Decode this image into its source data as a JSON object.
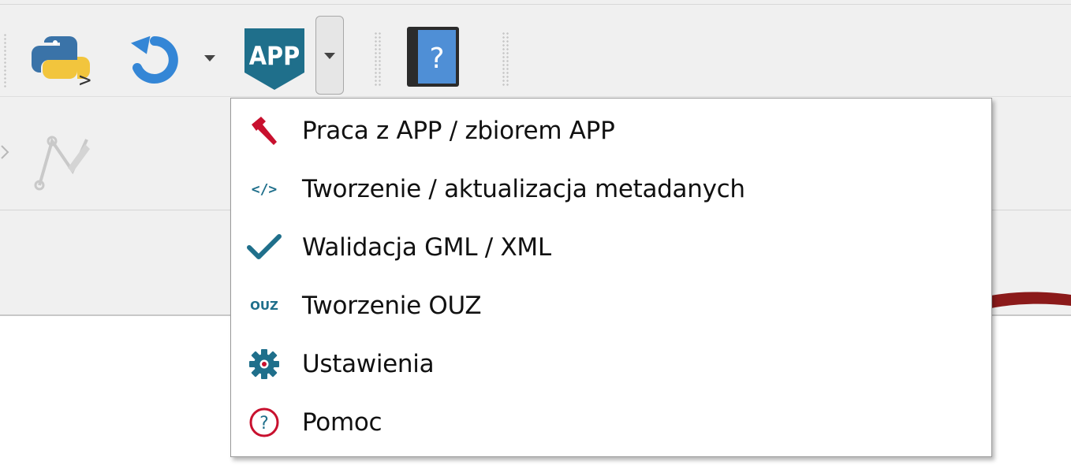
{
  "toolbar": {
    "python_button": "python-console",
    "refresh_button": "refresh",
    "app_button_badge": "APP",
    "help_book_mark": "?"
  },
  "menu": {
    "items": [
      {
        "label": "Praca z APP / zbiorem APP",
        "icon": "hammer-icon",
        "color": "#c8102e"
      },
      {
        "label": "Tworzenie / aktualizacja metadanych",
        "icon": "code-tag-icon",
        "icon_text": "</>",
        "color": "#c8102e"
      },
      {
        "label": "Walidacja GML / XML",
        "icon": "checkmark-icon",
        "color": "#1f6f8b"
      },
      {
        "label": "Tworzenie OUZ",
        "icon": "ouz-icon",
        "icon_text": "OUZ",
        "color": "#1f6f8b"
      },
      {
        "label": "Ustawienia",
        "icon": "gear-icon",
        "color": "#1f6f8b"
      },
      {
        "label": "Pomoc",
        "icon": "help-circle-icon",
        "icon_text": "?",
        "color": "#c8102e"
      }
    ]
  },
  "colors": {
    "toolbar_bg": "#f0f0f0",
    "menu_border": "#9a9a9a",
    "app_teal": "#1f6f8b",
    "accent_red": "#c8102e",
    "annotation_arrow": "#8b1a1a"
  }
}
